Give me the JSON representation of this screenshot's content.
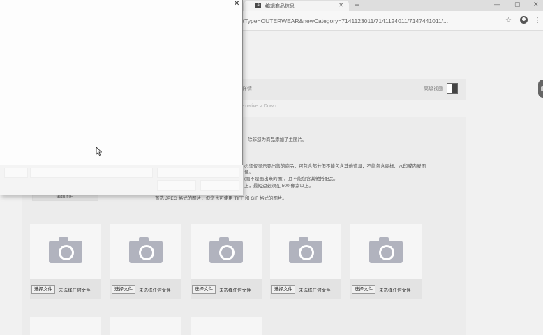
{
  "browser": {
    "tab_title": "编辑商品信息",
    "tab_icon_letter": "a",
    "url": "oats&productType=OUTERWEAR&newCategory=7141123011/7141124011/7147441011/..."
  },
  "page": {
    "subhead_left": "详情",
    "subhead_right": "高级视图",
    "breadcrumb": "ernative > Down",
    "notes": [
      "除非您为商品添加了主图片。",
      "必须仅显示要出售的商品，可包含部分但不能包含其他道具，不能包含商标、水印或内嵌图",
      "像。",
      "(而不是画出来的图)，且不能包含其他搭配品。",
      "上，最短边必须在 500 像素以上。",
      "首选 JPEG 格式的图片，但您也可使用 TIFF 和 GIF 格式的图片。"
    ],
    "edit_button": "编辑图片",
    "file_button": "选择文件",
    "file_status": "未选择任何文件"
  }
}
